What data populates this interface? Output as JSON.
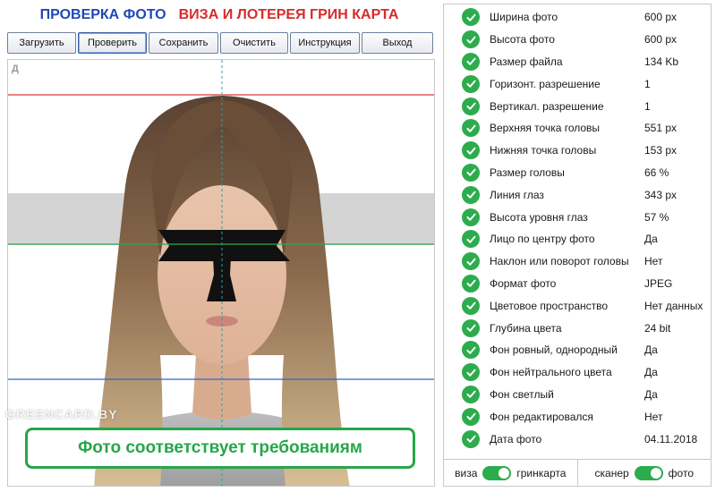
{
  "header": {
    "title_left": "ПРОВЕРКА ФОТО",
    "title_right": "ВИЗА И ЛОТЕРЕЯ ГРИН КАРТА",
    "title_left_color": "#1f49b6",
    "title_right_color": "#d82b2b"
  },
  "toolbar": {
    "buttons": [
      {
        "label": "Загрузить"
      },
      {
        "label": "Проверить"
      },
      {
        "label": "Сохранить"
      },
      {
        "label": "Очистить"
      },
      {
        "label": "Инструкция"
      },
      {
        "label": "Выход"
      }
    ]
  },
  "photo": {
    "corner_letter": "Д",
    "watermark": "GREENCARD.BY",
    "result_text": "Фото соответствует требованиям",
    "result_color": "#27a64a",
    "guide_colors": {
      "top": "#d43b3b",
      "eyes": "#2fa84f",
      "chin": "#3466c8",
      "center": "#2aa0a0"
    }
  },
  "checks": [
    {
      "label": "Ширина фото",
      "value": "600 px"
    },
    {
      "label": "Высота фото",
      "value": "600 px"
    },
    {
      "label": "Размер файла",
      "value": "134 Kb"
    },
    {
      "label": "Горизонт. разрешение",
      "value": "1"
    },
    {
      "label": "Вертикал. разрешение",
      "value": "1"
    },
    {
      "label": "Верхняя точка головы",
      "value": "551 px"
    },
    {
      "label": "Нижняя точка головы",
      "value": "153 px"
    },
    {
      "label": "Размер головы",
      "value": "66 %"
    },
    {
      "label": "Линия глаз",
      "value": "343 px"
    },
    {
      "label": "Высота уровня глаз",
      "value": "57 %"
    },
    {
      "label": "Лицо по центру фото",
      "value": "Да"
    },
    {
      "label": "Наклон или поворот головы",
      "value": "Нет"
    },
    {
      "label": "Формат фото",
      "value": "JPEG"
    },
    {
      "label": "Цветовое пространство",
      "value": "Нет данных"
    },
    {
      "label": "Глубина цвета",
      "value": "24 bit"
    },
    {
      "label": "Фон ровный, однородный",
      "value": "Да"
    },
    {
      "label": "Фон нейтрального цвета",
      "value": "Да"
    },
    {
      "label": "Фон светлый",
      "value": "Да"
    },
    {
      "label": "Фон редактировался",
      "value": "Нет"
    },
    {
      "label": "Дата фото",
      "value": "04.11.2018"
    }
  ],
  "footer": {
    "toggle1_left": "виза",
    "toggle1_right": "гринкарта",
    "toggle2_left": "сканер",
    "toggle2_right": "фото",
    "switch_color": "#2dac4d"
  }
}
